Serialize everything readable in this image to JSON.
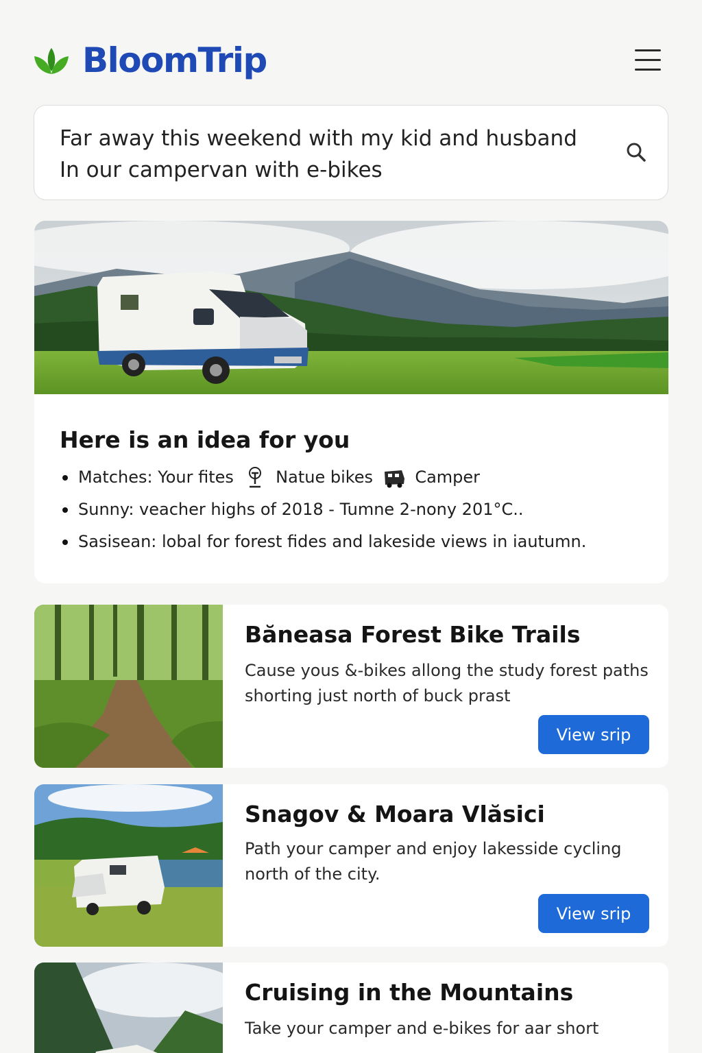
{
  "app": {
    "name": "BloomTrip"
  },
  "search": {
    "line1": "Far away this weekend with my kid and husband",
    "line2": "In our campervan with e-bikes"
  },
  "idea": {
    "title": "Here is an idea for you",
    "matches_prefix": "Matches: Your fites",
    "matches_bikes": "Natue bikes",
    "matches_camper": "Camper",
    "weather": "Sunny: veacher highs of 2018 - Tumne 2-nony 201°C..",
    "season": "Sasisean: lobal for forest fides and lakeside views in iautumn."
  },
  "trips": [
    {
      "title": "Băneasa Forest Bike Trails",
      "desc_line1": "Cause yous &-bikes allong the study forest paths",
      "desc_line2": "shorting just north of buck prast",
      "button": "View srip"
    },
    {
      "title": "Snagov & Moara Vlăsici",
      "desc_line1": "Path your camper and enjoy lakesside cycling",
      "desc_line2": "north of the city.",
      "button": "View srip"
    },
    {
      "title": "Cruising in the Mountains",
      "desc_line1": "Take your camper and e-bikes for aar short",
      "desc_line2": ""
    }
  ],
  "icons": {
    "logo": "leaf-logo-icon",
    "menu": "hamburger-menu-icon",
    "search": "search-icon",
    "bike": "bike-icon",
    "camper": "camper-icon"
  },
  "colors": {
    "brand": "#1f49b5",
    "leaf": "#3aa321",
    "button": "#1d6ad8"
  }
}
